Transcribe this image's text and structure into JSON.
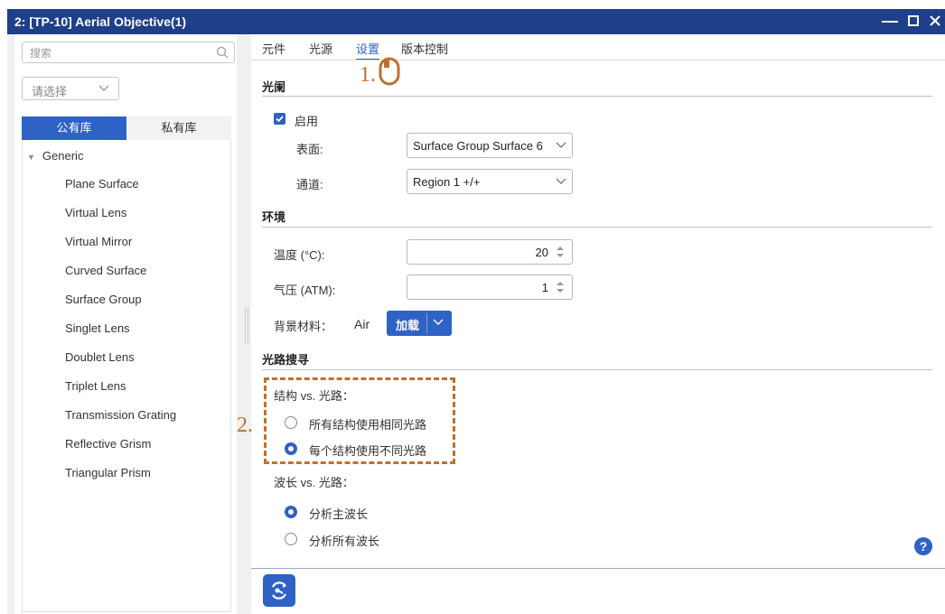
{
  "window": {
    "title": "2: [TP-10] Aerial Objective(1)",
    "controls": {
      "minimize": "—",
      "maximize": "☐",
      "close": "✕"
    }
  },
  "sidebar": {
    "search_placeholder": "搜索",
    "select_placeholder": "请选择",
    "tabs": [
      {
        "label": "公有库",
        "active": true
      },
      {
        "label": "私有库",
        "active": false
      }
    ],
    "tree": {
      "root": "Generic",
      "items": [
        "Plane Surface",
        "Virtual Lens",
        "Virtual Mirror",
        "Curved Surface",
        "Surface Group",
        "Singlet Lens",
        "Doublet Lens",
        "Triplet Lens",
        "Transmission Grating",
        "Reflective Grism",
        "Triangular Prism"
      ]
    }
  },
  "tabs": [
    {
      "label": "元件",
      "active": false
    },
    {
      "label": "光源",
      "active": false
    },
    {
      "label": "设置",
      "active": true
    },
    {
      "label": "版本控制",
      "active": false
    }
  ],
  "aperture": {
    "title": "光阑",
    "enable_label": "启用",
    "enabled": true,
    "surface_label": "表面:",
    "surface_value": "Surface Group Surface 6",
    "channel_label": "通道:",
    "channel_value": "Region 1 +/+"
  },
  "environment": {
    "title": "环境",
    "temperature_label": "温度 (°C):",
    "temperature_value": "20",
    "pressure_label": "气压 (ATM):",
    "pressure_value": "1",
    "background_material_label": "背景材料：",
    "background_material_value": "Air",
    "load_button": "加载"
  },
  "ray_search": {
    "title": "光路搜寻",
    "structure_label": "结构 vs. 光路：",
    "structure_options": [
      {
        "label": "所有结构使用相同光路",
        "selected": false
      },
      {
        "label": "每个结构使用不同光路",
        "selected": true
      }
    ],
    "wavelength_label": "波长 vs. 光路：",
    "wavelength_options": [
      {
        "label": "分析主波长",
        "selected": true
      },
      {
        "label": "分析所有波长",
        "selected": false
      }
    ]
  },
  "annotations": {
    "step1": "1.",
    "step2": "2."
  },
  "help_label": "?",
  "colors": {
    "titlebar": "#1f3f8a",
    "accent": "#2f62c5",
    "annotation": "#c0702d"
  }
}
